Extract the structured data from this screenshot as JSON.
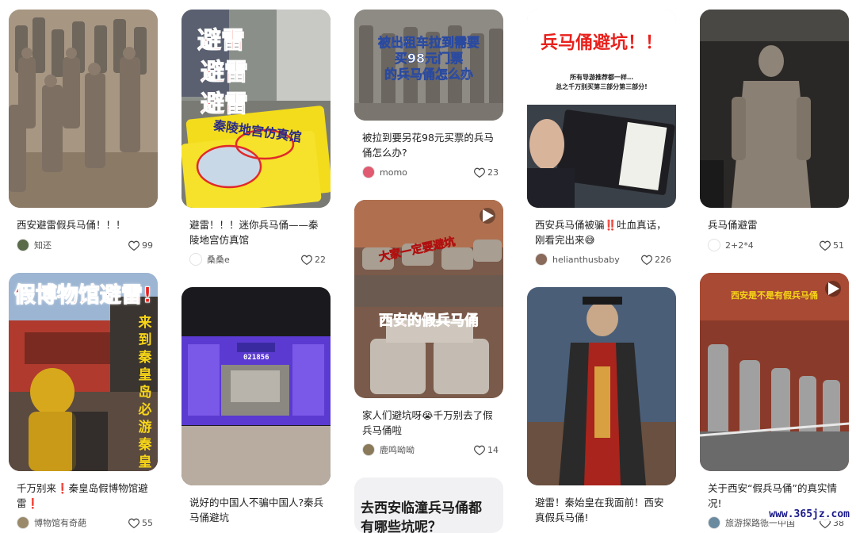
{
  "feed": {
    "columns": [
      {
        "cards": [
          {
            "title": "西安避雷假兵马俑！！！",
            "author": "知还",
            "likes": "99",
            "avatar_color": "#5a6b4a",
            "image_icon": "terracotta-army-photo"
          },
          {
            "title": "千万别来❗️秦皇岛假博物馆避雷❗️",
            "author": "博物馆有奇葩",
            "likes": "55",
            "avatar_color": "#9a8a6a",
            "image_icon": "gold-statue-photo",
            "overlay": {
              "banner": "假博物馆避雷!",
              "side": "来到秦皇岛必游秦皇宫"
            }
          }
        ]
      },
      {
        "cards": [
          {
            "title": "避雷！！！迷你兵马俑——秦陵地宫仿真馆",
            "author": "桑桑e",
            "likes": "22",
            "avatar_color": "#ffffff",
            "image_icon": "tickets-photo",
            "overlay": {
              "lines": [
                "避雷",
                "避雷",
                "避雷"
              ],
              "ticket": "秦陵地宫仿真馆"
            }
          },
          {
            "title": "说好的中国人不骗中国人?秦兵马俑避坑",
            "author": "",
            "likes": "",
            "avatar_color": "#cccccc",
            "image_icon": "screen-display-photo",
            "overlay": {
              "counter": "021856"
            }
          }
        ]
      },
      {
        "cards": [
          {
            "title": "被拉到要另花98元买票的兵马俑怎么办?",
            "author": "momo",
            "likes": "23",
            "avatar_color": "#e05a70",
            "image_icon": "terracotta-warriors-photo",
            "overlay": {
              "lines": [
                "被出租车拉到需要",
                "买98元门票",
                "的兵马俑怎么办"
              ]
            }
          },
          {
            "title": "家人们避坑呀😭千万别去了假兵马俑啦",
            "author": "鹿鸣呦呦",
            "likes": "14",
            "avatar_color": "#8a7a5a",
            "image_icon": "fake-army-photo",
            "overlay": {
              "top": "大家一定要避坑",
              "mid": "西安的假兵马俑"
            },
            "video": true
          },
          {
            "title": "",
            "author": "",
            "likes": "",
            "avatar_color": "#ccc",
            "image_icon": "text-cover",
            "overlay": {
              "lines": [
                "去西安临潼兵马俑都",
                "有哪些坑呢？"
              ]
            }
          }
        ]
      },
      {
        "cards": [
          {
            "title": "西安兵马俑被骗‼️吐血真话，刚看完出来😅",
            "author": "helianthusbaby",
            "likes": "226",
            "avatar_color": "#8a6a5a",
            "image_icon": "tickets-in-hand-photo",
            "overlay": {
              "head": "兵马俑避坑！！",
              "sub1": "所有导游推荐都一样…",
              "sub2": "总之千万别买第三部分第三部分!"
            }
          },
          {
            "title": "避雷！秦始皇在我面前！西安真假兵马俑!",
            "author": "",
            "likes": "",
            "avatar_color": "#ccc",
            "image_icon": "emperor-statue-photo"
          }
        ]
      },
      {
        "cards": [
          {
            "title": "兵马俑避雷",
            "author": "2+2*4",
            "likes": "51",
            "avatar_color": "#ffffff",
            "image_icon": "single-warrior-photo"
          },
          {
            "title": "关于西安“假兵马俑”的真实情况!",
            "author": "旅游探路德一中国",
            "likes": "38",
            "avatar_color": "#6a8aa0",
            "image_icon": "museum-warriors-photo",
            "overlay": {
              "head": "西安是不是有假兵马俑"
            },
            "video": true
          }
        ]
      }
    ]
  },
  "watermark": "www.365jz.com",
  "colors": {
    "title_text": "#222222",
    "meta_text": "#555555",
    "overlay_red": "#e8201c",
    "overlay_yellow": "#f7d517"
  }
}
